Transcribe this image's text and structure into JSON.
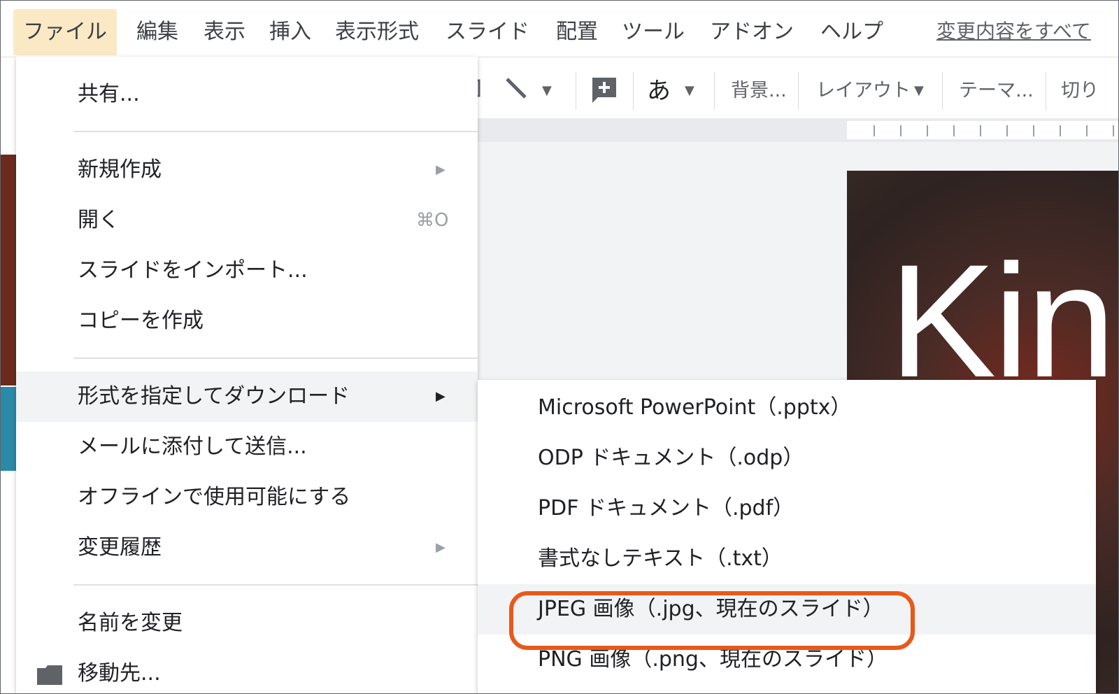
{
  "menubar": {
    "items": [
      "ファイル",
      "編集",
      "表示",
      "挿入",
      "表示形式",
      "スライド",
      "配置",
      "ツール",
      "アドオン",
      "ヘルプ"
    ],
    "changes_link": "変更内容をすべて"
  },
  "toolbar": {
    "text_style": "あ",
    "background": "背景...",
    "layout": "レイアウト",
    "theme": "テーマ...",
    "transition": "切り"
  },
  "slide": {
    "title": "Kin"
  },
  "file_menu": {
    "share": "共有...",
    "new": "新規作成",
    "open": "開く",
    "open_shortcut": "⌘O",
    "import_slides": "スライドをインポート...",
    "make_copy": "コピーを作成",
    "download_as": "形式を指定してダウンロード",
    "email_attachment": "メールに添付して送信...",
    "offline": "オフラインで使用可能にする",
    "version_history": "変更履歴",
    "rename": "名前を変更",
    "move_to": "移動先..."
  },
  "download_menu": {
    "items": [
      "Microsoft PowerPoint（.pptx）",
      "ODP ドキュメント（.odp）",
      "PDF ドキュメント（.pdf）",
      "書式なしテキスト（.txt）",
      "JPEG 画像（.jpg、現在のスライド）",
      "PNG 画像（.png、現在のスライド）"
    ],
    "highlighted_index": 4
  },
  "colors": {
    "highlight_ring": "#e8591a",
    "active_menu_bg": "#fbe9c6",
    "hover_bg": "#f1f3f4"
  }
}
